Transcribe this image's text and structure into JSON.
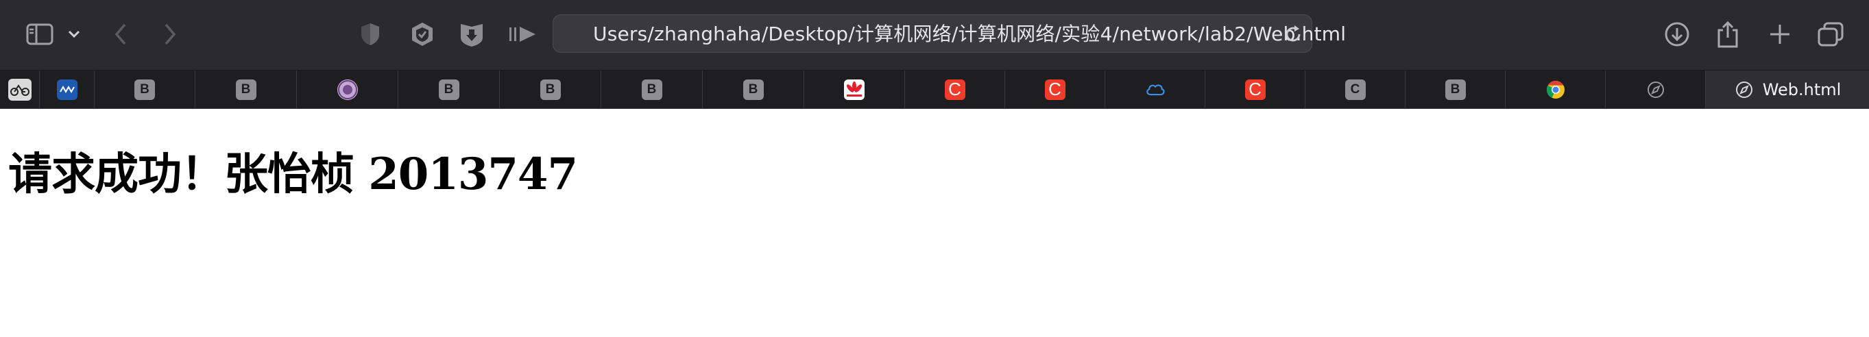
{
  "browser": {
    "address": "Users/zhanghaha/Desktop/计算机网络/计算机网络/实验4/network/lab2/Web.html",
    "icons": {
      "sidebar": "sidebar-icon",
      "dropdown": "chevron-down-icon",
      "back": "chevron-left-icon",
      "forward": "chevron-right-icon",
      "privacy": "shield-icon",
      "extension1": "badge-shield-icon",
      "extension2": "download-shield-icon",
      "reader": "reader-icon",
      "reload": "reload-icon",
      "downloads": "download-icon",
      "share": "share-icon",
      "new_tab": "plus-icon",
      "tab_overview": "tab-overview-icon"
    }
  },
  "tabs": [
    {
      "favicon": "bike-icon",
      "label": ""
    },
    {
      "favicon": "blue-logo-icon",
      "label": ""
    },
    {
      "favicon": "b-letter-icon",
      "label": "B"
    },
    {
      "favicon": "b-letter-icon",
      "label": "B"
    },
    {
      "favicon": "university-seal-icon",
      "label": ""
    },
    {
      "favicon": "b-letter-icon",
      "label": "B"
    },
    {
      "favicon": "b-letter-icon",
      "label": "B"
    },
    {
      "favicon": "b-letter-icon",
      "label": "B"
    },
    {
      "favicon": "b-letter-icon",
      "label": "B"
    },
    {
      "favicon": "huawei-icon",
      "label": ""
    },
    {
      "favicon": "c-red-icon",
      "label": "C"
    },
    {
      "favicon": "c-red-icon",
      "label": "C"
    },
    {
      "favicon": "cloud-icon",
      "label": ""
    },
    {
      "favicon": "c-red-icon",
      "label": "C"
    },
    {
      "favicon": "c-gray-icon",
      "label": "C"
    },
    {
      "favicon": "b-letter-icon",
      "label": "B"
    },
    {
      "favicon": "chrome-icon",
      "label": ""
    },
    {
      "favicon": "compass-icon",
      "label": ""
    },
    {
      "favicon": "compass-icon",
      "label": "Web.html"
    }
  ],
  "page": {
    "heading": "请求成功！张怡桢 2013747"
  },
  "colors": {
    "toolbar_bg": "#2b2a2c",
    "tabbar_bg": "#1e1e20",
    "red_favicon": "#f03a2a",
    "gray_favicon": "#8e8e93"
  }
}
